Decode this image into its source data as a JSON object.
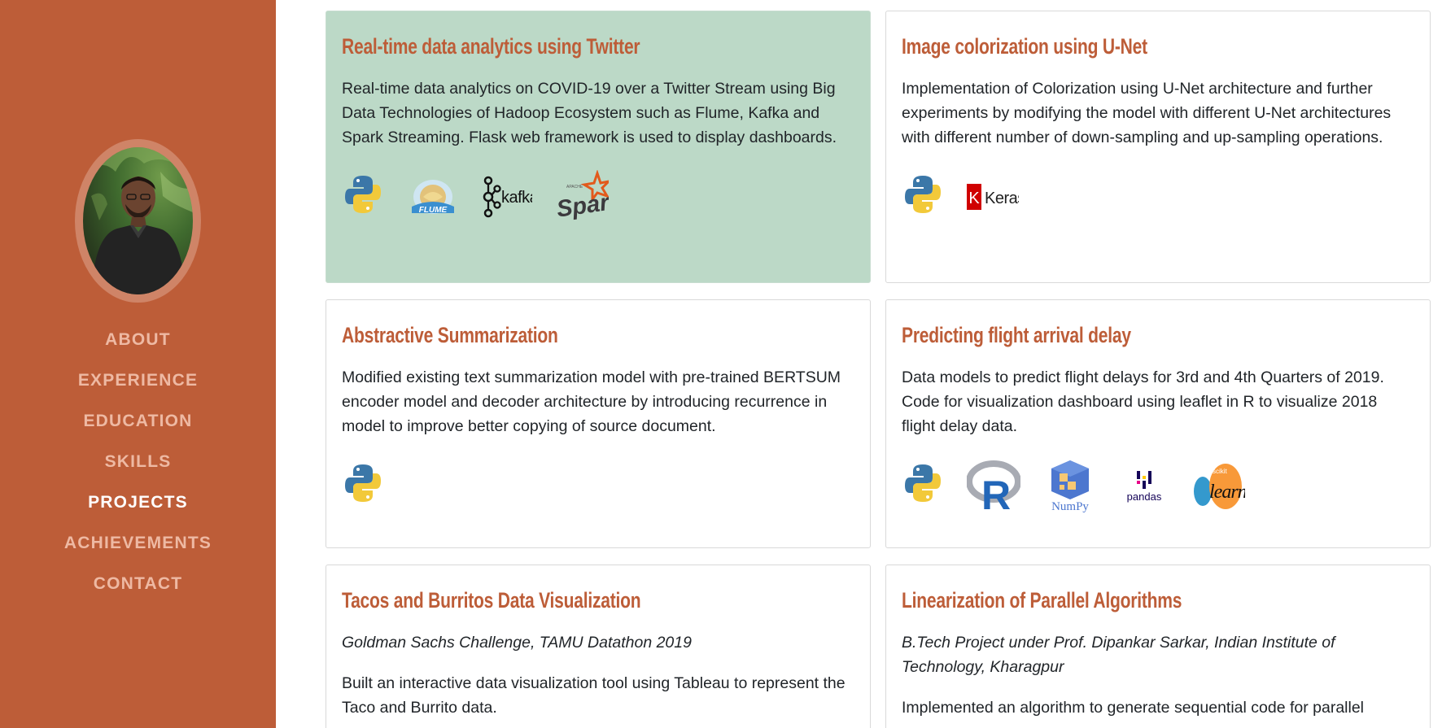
{
  "nav": {
    "items": [
      {
        "label": "About",
        "active": false
      },
      {
        "label": "Experience",
        "active": false
      },
      {
        "label": "Education",
        "active": false
      },
      {
        "label": "Skills",
        "active": false
      },
      {
        "label": "Projects",
        "active": true
      },
      {
        "label": "Achievements",
        "active": false
      },
      {
        "label": "Contact",
        "active": false
      }
    ]
  },
  "colors": {
    "sidebar": "#bd5d38",
    "nav_inactive": "#eeb9a3",
    "nav_active": "#ffffff",
    "title": "#bd5d38",
    "highlight_card": "#bcd9c7"
  },
  "projects": [
    {
      "title": "Real-time data analytics using Twitter",
      "description": "Real-time data analytics on COVID-19 over a Twitter Stream using Big Data Technologies of Hadoop Ecosystem such as Flume, Kafka and Spark Streaming. Flask web framework is used to display dashboards.",
      "highlighted": true,
      "tech": [
        {
          "icon": "python-logo-icon",
          "label": "python"
        },
        {
          "icon": "flume-logo-icon",
          "label": "FLUME"
        },
        {
          "icon": "kafka-logo-icon",
          "label": "kafka"
        },
        {
          "icon": "spark-logo-icon",
          "label": "Spark",
          "sub": "APACHE"
        }
      ]
    },
    {
      "title": "Image colorization using U-Net",
      "description": "Implementation of Colorization using U-Net architecture and further experiments by modifying the model with different U-Net architectures with different number of down-sampling and up-sampling operations.",
      "highlighted": false,
      "tech": [
        {
          "icon": "python-logo-icon",
          "label": "python"
        },
        {
          "icon": "keras-logo-icon",
          "label": "Keras",
          "mark": "K"
        }
      ]
    },
    {
      "title": "Abstractive Summarization",
      "description": "Modified existing text summarization model with pre-trained BERTSUM encoder model and decoder architecture by introducing recurrence in model to improve better copying of source document.",
      "highlighted": false,
      "tech": [
        {
          "icon": "python-logo-icon",
          "label": "python"
        }
      ]
    },
    {
      "title": "Predicting flight arrival delay",
      "description": "Data models to predict flight delays for 3rd and 4th Quarters of 2019. Code for visualization dashboard using leaflet in R to visualize 2018 flight delay data.",
      "highlighted": false,
      "tech": [
        {
          "icon": "python-logo-icon",
          "label": "python"
        },
        {
          "icon": "r-logo-icon",
          "label": "R"
        },
        {
          "icon": "numpy-logo-icon",
          "label": "NumPy"
        },
        {
          "icon": "pandas-logo-icon",
          "label": "pandas"
        },
        {
          "icon": "sklearn-logo-icon",
          "label": "learn"
        }
      ]
    },
    {
      "title": "Tacos and Burritos Data Visualization",
      "subtitle": "Goldman Sachs Challenge, TAMU Datathon 2019",
      "description": "Built an interactive data visualization tool using Tableau to represent the Taco and Burrito data.",
      "highlighted": false,
      "tech": []
    },
    {
      "title": "Linearization of Parallel Algorithms",
      "subtitle": "B.Tech Project under Prof. Dipankar Sarkar, Indian Institute of Technology, Kharagpur",
      "description": "Implemented an algorithm to generate sequential code for parallel",
      "highlighted": false,
      "tech": []
    }
  ]
}
